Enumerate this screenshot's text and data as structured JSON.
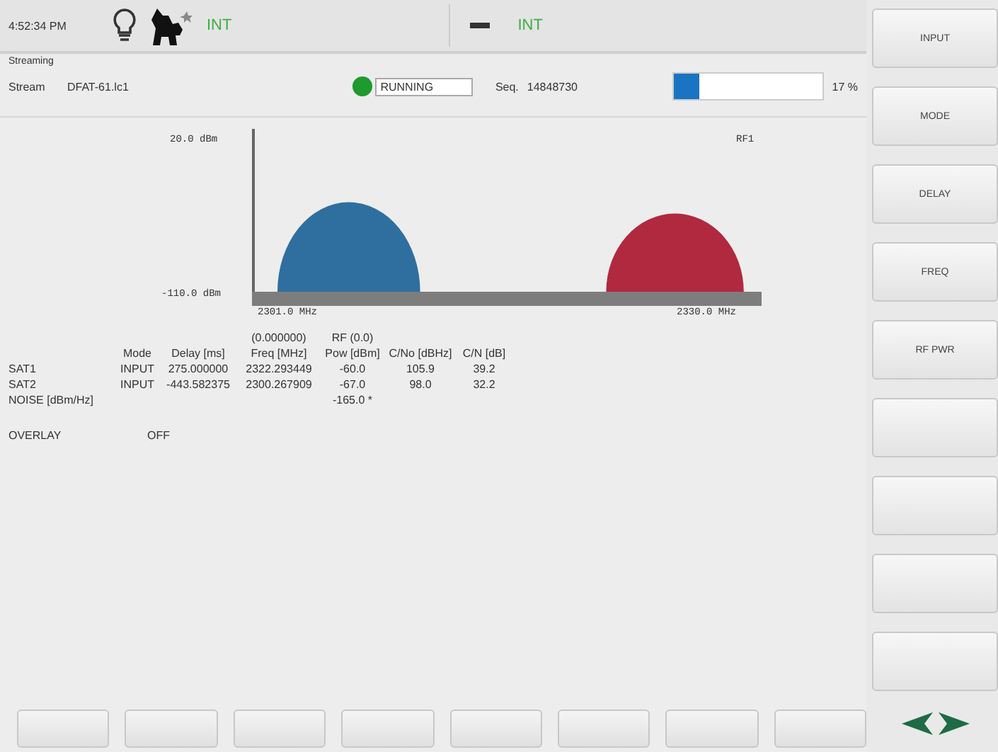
{
  "top_bar": {
    "time": "4:52:34 PM",
    "reference_left": "INT",
    "reference_right": "INT"
  },
  "streaming": {
    "group_label": "Streaming",
    "label": "Stream",
    "file": "DFAT-61.lc1",
    "status": "RUNNING",
    "seq_label": "Seq.",
    "seq": "14848730",
    "progress": {
      "level": 0.17,
      "reading": "17 %"
    }
  },
  "spectrum": {
    "y_top": "20.0 dBm",
    "y_bottom": "-110.0 dBm",
    "x_left": "2301.0 MHz",
    "x_right": "2330.0 MHz",
    "port": "RF1",
    "signals": [
      {
        "color": "#2f6f9f"
      },
      {
        "color": "#b0293f"
      }
    ]
  },
  "table": {
    "freq_note": "(0.000000)",
    "pow_note": "RF (0.0)",
    "columns": [
      "Mode",
      "Delay [ms]",
      "Freq [MHz]",
      "Pow [dBm]",
      "C/No [dBHz]",
      "C/N [dB]"
    ],
    "rows": [
      {
        "name": "SAT1",
        "cells": [
          "INPUT",
          "275.000000",
          "2322.293449",
          "-60.0",
          "105.9",
          "39.2"
        ]
      },
      {
        "name": "SAT2",
        "cells": [
          "INPUT",
          "-443.582375",
          "2300.267909",
          "-67.0",
          "98.0",
          "32.2"
        ]
      }
    ],
    "noise": {
      "label": "NOISE [dBm/Hz]",
      "pow": "-165.0 *"
    }
  },
  "overlay": {
    "label": "OVERLAY",
    "value": "OFF"
  },
  "side_buttons": [
    "INPUT",
    "MODE",
    "DELAY",
    "FREQ",
    "RF PWR"
  ]
}
